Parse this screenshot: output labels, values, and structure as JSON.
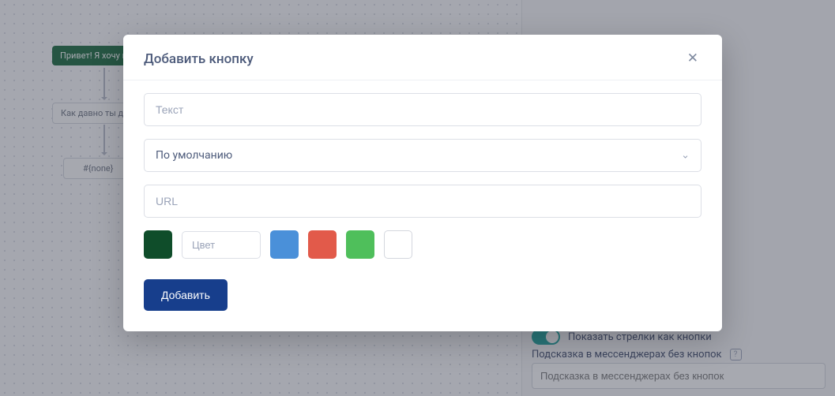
{
  "canvas": {
    "node_greeting": "Привет! Я хочу п",
    "node_question": "Как давно ты де",
    "node_none": "#{none}"
  },
  "sidebar": {
    "toggle_label": "Показать стрелки как кнопки",
    "hint_label": "Подсказка в мессенджерах без кнопок",
    "hint_placeholder": "Подсказка в мессенджерах без кнопок"
  },
  "modal": {
    "title": "Добавить кнопку",
    "text_placeholder": "Текст",
    "select_value": "По умолчанию",
    "url_placeholder": "URL",
    "color_placeholder": "Цвет",
    "submit_label": "Добавить"
  }
}
